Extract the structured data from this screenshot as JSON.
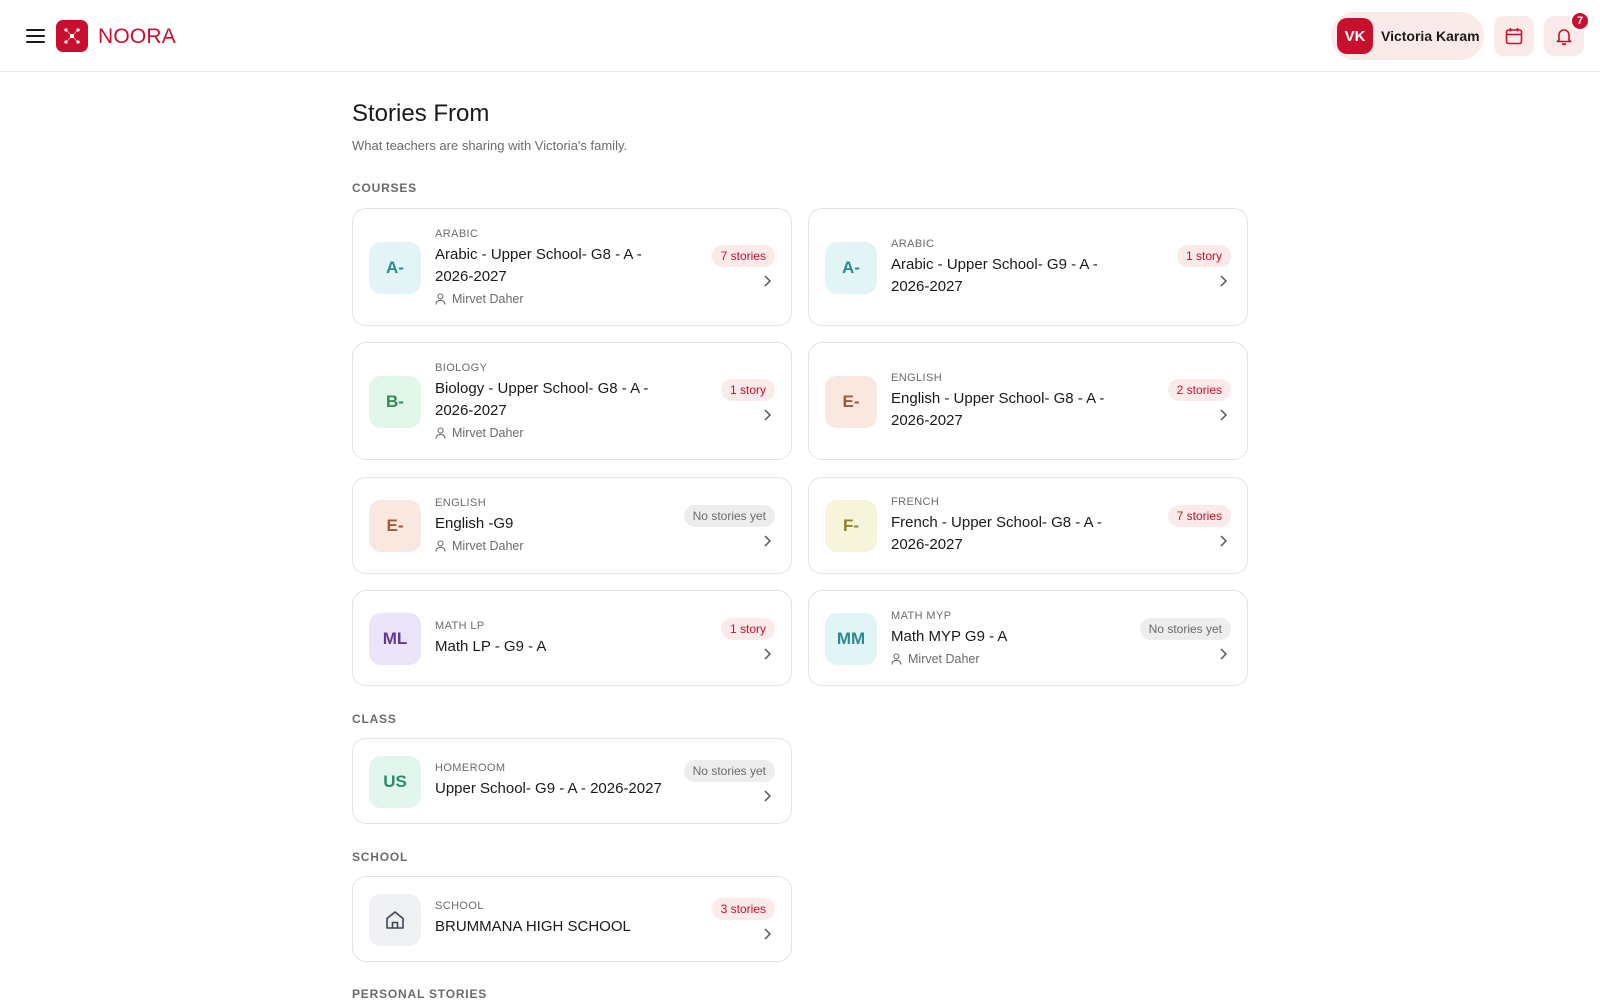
{
  "brand": {
    "name": "NOORA"
  },
  "header": {
    "user_initials": "VK",
    "user_name": "Victoria Karam",
    "notification_count": "7"
  },
  "page": {
    "title": "Stories From",
    "subtitle": "What teachers are sharing with Victoria's family."
  },
  "sections": {
    "courses": "COURSES",
    "class": "CLASS",
    "school": "SCHOOL",
    "personal": "PERSONAL STORIES"
  },
  "courses": [
    {
      "initials": "A-",
      "category": "ARABIC",
      "title_line1": "Arabic - Upper School- G8 - A -",
      "title_line2": "2026-2027",
      "teacher": "Mirvet Daher",
      "badge": "7 stories"
    },
    {
      "initials": "A-",
      "category": "ARABIC",
      "title_line1": "Arabic - Upper School- G9 - A -",
      "title_line2": "2026-2027",
      "teacher": "",
      "badge": "1 story"
    },
    {
      "initials": "B-",
      "category": "BIOLOGY",
      "title_line1": "Biology - Upper School- G8 - A -",
      "title_line2": "2026-2027",
      "teacher": "Mirvet Daher",
      "badge": "1 story"
    },
    {
      "initials": "E-",
      "category": "ENGLISH",
      "title_line1": "English - Upper School- G8 - A -",
      "title_line2": "2026-2027",
      "teacher": "",
      "badge": "2 stories"
    },
    {
      "initials": "E-",
      "category": "ENGLISH",
      "title_line1": "English -G9",
      "title_line2": "",
      "teacher": "Mirvet Daher",
      "badge": "No stories yet"
    },
    {
      "initials": "F-",
      "category": "FRENCH",
      "title_line1": "French - Upper School- G8 - A -",
      "title_line2": "2026-2027",
      "teacher": "",
      "badge": "7 stories"
    },
    {
      "initials": "ML",
      "category": "MATH LP",
      "title_line1": "Math LP - G9 - A",
      "title_line2": "",
      "teacher": "",
      "badge": "1 story"
    },
    {
      "initials": "MM",
      "category": "MATH MYP",
      "title_line1": "Math MYP G9 - A",
      "title_line2": "",
      "teacher": "Mirvet Daher",
      "badge": "No stories yet"
    }
  ],
  "class_card": {
    "initials": "US",
    "category": "HOMEROOM",
    "title_line1": "Upper School- G9 - A - 2026-2027",
    "badge": "No stories yet"
  },
  "school_card": {
    "icon": "home-icon",
    "category": "SCHOOL",
    "title_line1": "BRUMMANA HIGH SCHOOL",
    "badge": "3 stories"
  },
  "colors": {
    "brand": "#c8102e",
    "avatar_teal_bg": "#e3f4f6",
    "avatar_teal_fg": "#2a8a96",
    "avatar_green_bg": "#e2f6ea",
    "avatar_green_fg": "#2e8b4f",
    "avatar_peach_bg": "#f8e8e0",
    "avatar_peach_fg": "#9c5a36",
    "avatar_olive_bg": "#f6f5dc",
    "avatar_olive_fg": "#8d8625",
    "avatar_purple_bg": "#ece4f8",
    "avatar_purple_fg": "#5e3a96",
    "avatar_mint_bg": "#e2f6ee",
    "avatar_mint_fg": "#2e8b6a"
  }
}
